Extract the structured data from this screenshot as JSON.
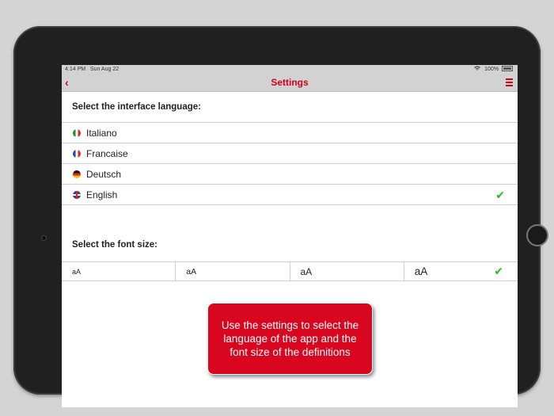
{
  "status_bar": {
    "time": "4:14 PM",
    "date": "Sun Aug 22",
    "battery": "100%"
  },
  "nav": {
    "title": "Settings"
  },
  "language_section": {
    "label": "Select the interface language:",
    "items": [
      {
        "label": "Italiano",
        "flag": "italy-flag-icon",
        "selected": false
      },
      {
        "label": "Francaise",
        "flag": "france-flag-icon",
        "selected": false
      },
      {
        "label": "Deutsch",
        "flag": "germany-flag-icon",
        "selected": false
      },
      {
        "label": "English",
        "flag": "uk-flag-icon",
        "selected": true
      }
    ]
  },
  "font_section": {
    "label": "Select the font size:",
    "options": [
      {
        "label": "aA",
        "selected": false
      },
      {
        "label": "aA",
        "selected": false
      },
      {
        "label": "aA",
        "selected": false
      },
      {
        "label": "aA",
        "selected": true
      }
    ]
  },
  "callout": {
    "text": "Use the settings to select the language of the app and the font size of the definitions"
  },
  "colors": {
    "accent": "#d0021b",
    "check": "#1fbf1f",
    "callout_bg": "#d9061f",
    "bar_bg": "#d2d2d2"
  },
  "icons": {
    "check": "✔",
    "back": "‹"
  }
}
